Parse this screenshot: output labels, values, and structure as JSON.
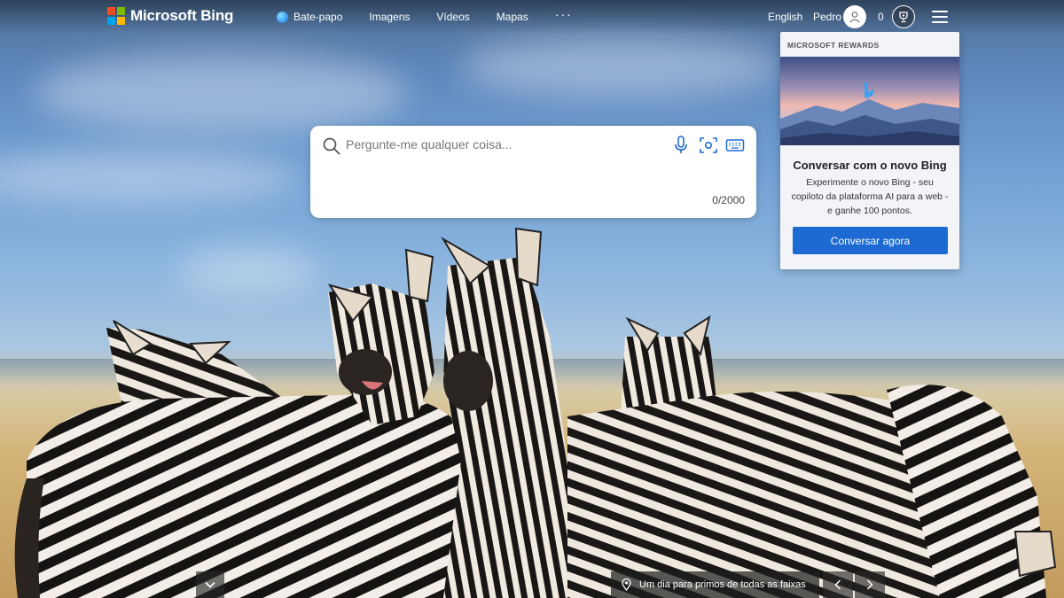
{
  "header": {
    "brand": "Microsoft Bing",
    "nav": [
      {
        "label": "Bate-papo",
        "icon": "chat-bubble-icon"
      },
      {
        "label": "Imagens"
      },
      {
        "label": "Vídeos"
      },
      {
        "label": "Mapas"
      }
    ],
    "more_label": "···",
    "language": "English",
    "user_name": "Pedro",
    "rewards_points": "0"
  },
  "search": {
    "placeholder": "Pergunte-me qualquer coisa...",
    "value": "",
    "char_counter": "0/2000"
  },
  "rewards_card": {
    "heading": "MICROSOFT REWARDS",
    "title": "Conversar com o novo Bing",
    "text": "Experimente o novo Bing - seu copiloto da plataforma AI para a web - e ganhe 100 pontos.",
    "button_label": "Conversar agora"
  },
  "footer": {
    "caption": "Um dia para primos de todas as faixas"
  },
  "colors": {
    "accent_blue": "#1d6ad2",
    "ms_red": "#f25022",
    "ms_green": "#7fba00",
    "ms_blue": "#00a4ef",
    "ms_yellow": "#ffb900"
  }
}
